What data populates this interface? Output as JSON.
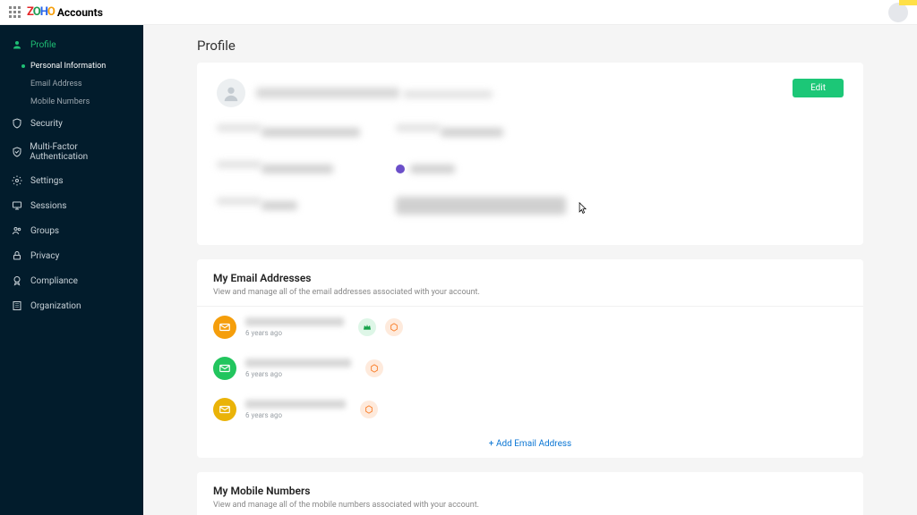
{
  "app": {
    "name": "Accounts"
  },
  "sidebar": {
    "items": [
      {
        "label": "Profile"
      },
      {
        "label": "Security"
      },
      {
        "label": "Multi-Factor Authentication"
      },
      {
        "label": "Settings"
      },
      {
        "label": "Sessions"
      },
      {
        "label": "Groups"
      },
      {
        "label": "Privacy"
      },
      {
        "label": "Compliance"
      },
      {
        "label": "Organization"
      }
    ],
    "profile_subs": [
      {
        "label": "Personal Information"
      },
      {
        "label": "Email Address"
      },
      {
        "label": "Mobile Numbers"
      }
    ]
  },
  "page": {
    "title": "Profile"
  },
  "profile_card": {
    "edit": "Edit"
  },
  "emails": {
    "title": "My Email Addresses",
    "desc": "View and manage all of the email addresses associated with your account.",
    "rows": [
      {
        "time": "6 years ago"
      },
      {
        "time": "6 years ago"
      },
      {
        "time": "6 years ago"
      }
    ],
    "add": "Add Email Address"
  },
  "mobiles": {
    "title": "My Mobile Numbers",
    "desc": "View and manage all of the mobile numbers associated with your account."
  }
}
